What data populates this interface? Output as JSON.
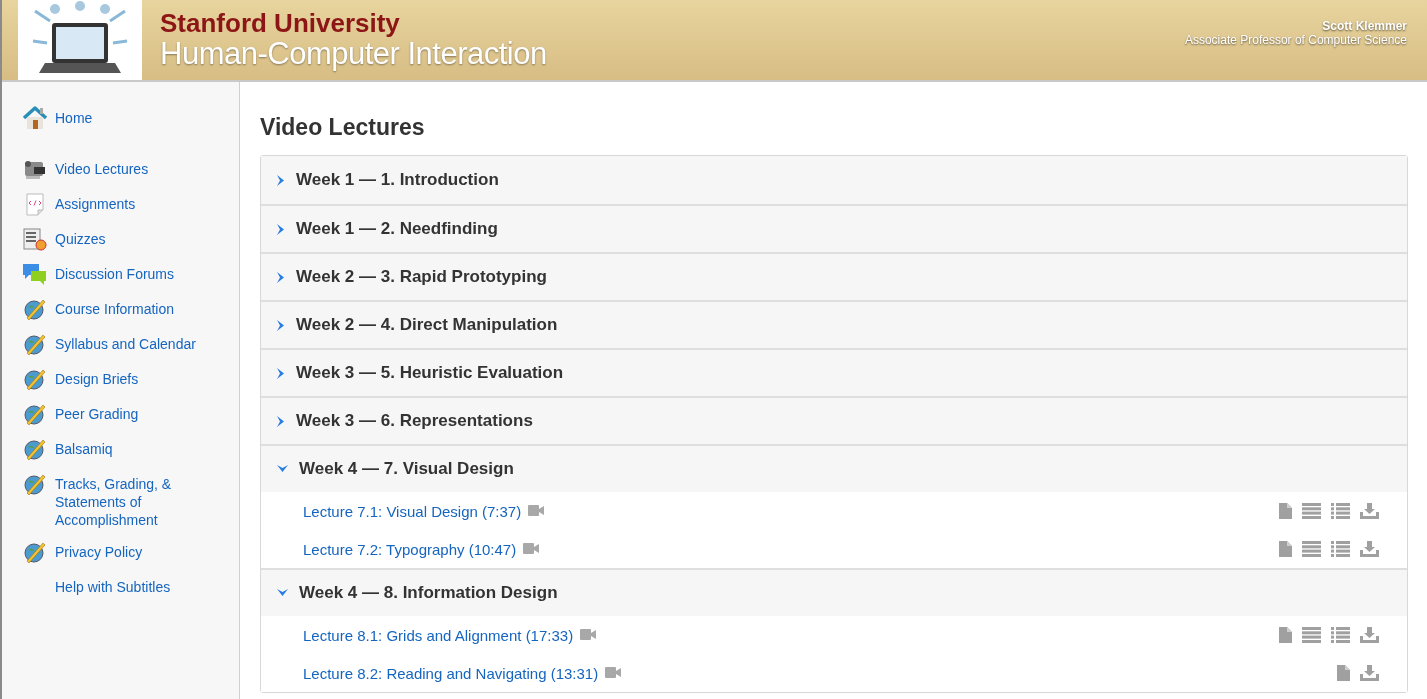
{
  "header": {
    "university": "Stanford University",
    "course": "Human-Computer Interaction",
    "instructor": "Scott Klemmer",
    "instructor_title": "Associate Professor of Computer Science"
  },
  "sidebar": {
    "items": [
      {
        "label": "Home",
        "kind": "home"
      },
      {
        "label": "Video Lectures",
        "kind": "camera"
      },
      {
        "label": "Assignments",
        "kind": "code"
      },
      {
        "label": "Quizzes",
        "kind": "quiz"
      },
      {
        "label": "Discussion Forums",
        "kind": "chat"
      },
      {
        "label": "Course Information",
        "kind": "globe"
      },
      {
        "label": "Syllabus and Calendar",
        "kind": "globe"
      },
      {
        "label": "Design Briefs",
        "kind": "globe"
      },
      {
        "label": "Peer Grading",
        "kind": "globe"
      },
      {
        "label": "Balsamiq",
        "kind": "globe"
      },
      {
        "label": "Tracks, Grading, & Statements of Accomplishment",
        "kind": "globe"
      },
      {
        "label": "Privacy Policy",
        "kind": "globe"
      },
      {
        "label": "Help with Subtitles",
        "kind": "plain"
      }
    ]
  },
  "page_title": "Video Lectures",
  "weeks": [
    {
      "title": "Week 1 — 1. Introduction",
      "expanded": false
    },
    {
      "title": "Week 1 — 2. Needfinding",
      "expanded": false
    },
    {
      "title": "Week 2 — 3. Rapid Prototyping",
      "expanded": false
    },
    {
      "title": "Week 2 — 4. Direct Manipulation",
      "expanded": false
    },
    {
      "title": "Week 3 — 5. Heuristic Evaluation",
      "expanded": false
    },
    {
      "title": "Week 3 — 6. Representations",
      "expanded": false
    },
    {
      "title": "Week 4 — 7. Visual Design",
      "expanded": true,
      "lectures": [
        {
          "title": "Lecture 7.1: Visual Design (7:37)",
          "resources": [
            {
              "kind": "slides"
            },
            {
              "kind": "subtitles"
            },
            {
              "kind": "transcript"
            },
            {
              "kind": "download"
            }
          ]
        },
        {
          "title": "Lecture 7.2: Typography (10:47)",
          "resources": [
            {
              "kind": "slides"
            },
            {
              "kind": "subtitles"
            },
            {
              "kind": "transcript"
            },
            {
              "kind": "download"
            }
          ]
        }
      ]
    },
    {
      "title": "Week 4 — 8. Information Design",
      "expanded": true,
      "lectures": [
        {
          "title": "Lecture 8.1: Grids and Alignment (17:33)",
          "resources": [
            {
              "kind": "slides"
            },
            {
              "kind": "subtitles"
            },
            {
              "kind": "transcript"
            },
            {
              "kind": "download"
            }
          ]
        },
        {
          "title": "Lecture 8.2: Reading and Navigating (13:31)",
          "resources": [
            {
              "kind": "slides"
            },
            {
              "kind": "download"
            }
          ]
        }
      ]
    }
  ]
}
